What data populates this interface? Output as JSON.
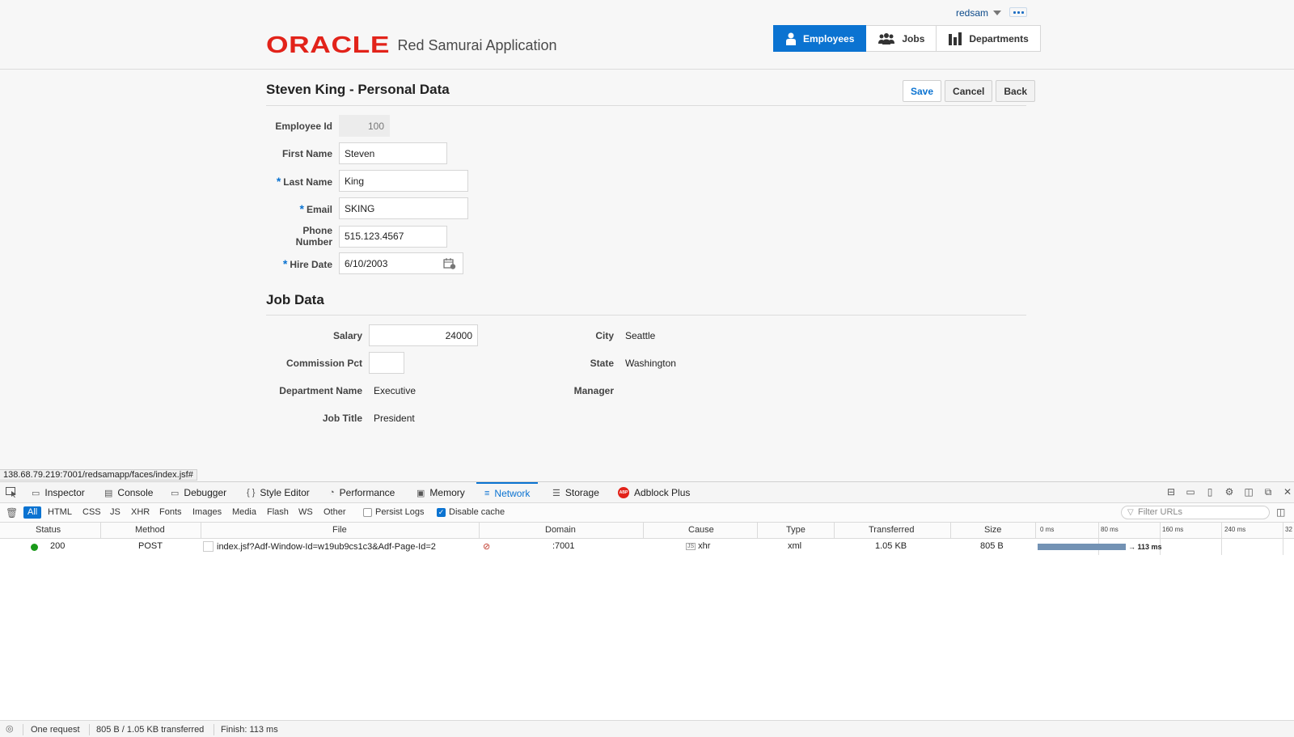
{
  "header": {
    "user": "redsam",
    "logo_brand": "ORACLE",
    "logo_app": "Red Samurai Application",
    "nav": {
      "employees": "Employees",
      "jobs": "Jobs",
      "departments": "Departments"
    }
  },
  "page": {
    "title": "Steven King - Personal Data",
    "actions": {
      "save": "Save",
      "cancel": "Cancel",
      "back": "Back"
    }
  },
  "personal": {
    "employee_id": {
      "label": "Employee Id",
      "value": "100"
    },
    "first_name": {
      "label": "First Name",
      "value": "Steven"
    },
    "last_name": {
      "label": "Last Name",
      "value": "King"
    },
    "email": {
      "label": "Email",
      "value": "SKING"
    },
    "phone": {
      "label": "Phone Number",
      "value": "515.123.4567"
    },
    "hire_date": {
      "label": "Hire Date",
      "value": "6/10/2003"
    }
  },
  "job": {
    "section_title": "Job Data",
    "salary": {
      "label": "Salary",
      "value": "24000"
    },
    "commission": {
      "label": "Commission Pct",
      "value": ""
    },
    "department": {
      "label": "Department Name",
      "value": "Executive"
    },
    "job_title": {
      "label": "Job Title",
      "value": "President"
    },
    "city": {
      "label": "City",
      "value": "Seattle"
    },
    "state": {
      "label": "State",
      "value": "Washington"
    },
    "manager": {
      "label": "Manager",
      "value": ""
    }
  },
  "status_url": "138.68.79.219:7001/redsamapp/faces/index.jsf#",
  "devtools": {
    "tabs": {
      "inspector": "Inspector",
      "console": "Console",
      "debugger": "Debugger",
      "style_editor": "Style Editor",
      "performance": "Performance",
      "memory": "Memory",
      "network": "Network",
      "storage": "Storage",
      "adblock": "Adblock Plus"
    },
    "filters": {
      "all": "All",
      "html": "HTML",
      "css": "CSS",
      "js": "JS",
      "xhr": "XHR",
      "fonts": "Fonts",
      "images": "Images",
      "media": "Media",
      "flash": "Flash",
      "ws": "WS",
      "other": "Other"
    },
    "persist_logs": "Persist Logs",
    "disable_cache": "Disable cache",
    "filter_placeholder": "Filter URLs",
    "columns": {
      "status": "Status",
      "method": "Method",
      "file": "File",
      "domain": "Domain",
      "cause": "Cause",
      "type": "Type",
      "transferred": "Transferred",
      "size": "Size"
    },
    "ticks": {
      "t0": "0 ms",
      "t1": "80 ms",
      "t2": "160 ms",
      "t3": "240 ms",
      "t4": "32"
    },
    "request": {
      "status": "200",
      "method": "POST",
      "file": "index.jsf?Adf-Window-Id=w19ub9cs1c3&Adf-Page-Id=2",
      "domain": ":7001",
      "cause": "xhr",
      "type": "xml",
      "transferred": "1.05 KB",
      "size": "805 B",
      "timing": "→ 113 ms"
    },
    "summary": {
      "requests": "One request",
      "transferred": "805 B / 1.05 KB transferred",
      "finish": "Finish: 113 ms"
    }
  },
  "colors": {
    "accent": "#0b73d1",
    "oracle_red": "#e2231a",
    "status_ok": "#1a9a1a"
  }
}
